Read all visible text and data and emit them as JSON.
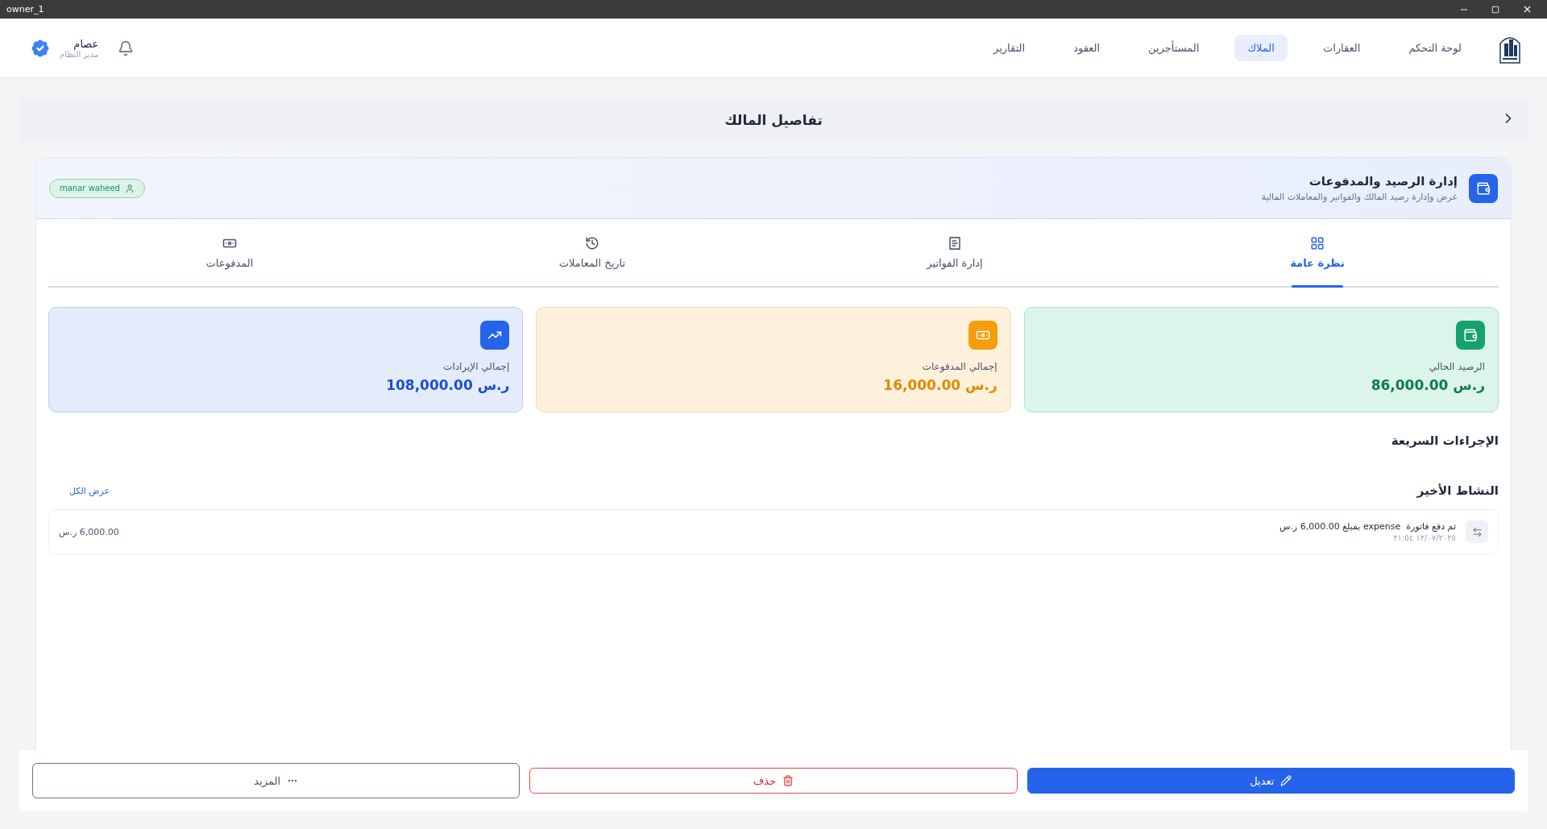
{
  "window": {
    "title": "owner_1"
  },
  "nav": {
    "items": [
      {
        "label": "لوحة التحكم",
        "selected": false
      },
      {
        "label": "العقارات",
        "selected": false
      },
      {
        "label": "الملاك",
        "selected": true
      },
      {
        "label": "المستأجرين",
        "selected": false
      },
      {
        "label": "العقود",
        "selected": false
      },
      {
        "label": "التقارير",
        "selected": false
      }
    ]
  },
  "user": {
    "name": "عصام",
    "role": "مدير النظام"
  },
  "page_title": "تفاصيل المالك",
  "section": {
    "title": "إدارة الرصيد والمدفوعات",
    "subtitle": "عرض وإدارة رصيد المالك والفواتير والمعاملات المالية",
    "owner_tag": "manar waheed"
  },
  "tabs": [
    {
      "label": "نظرة عامة",
      "selected": true,
      "kind": "grid"
    },
    {
      "label": "إدارة الفواتير",
      "selected": false,
      "kind": "invoice"
    },
    {
      "label": "تاريخ المعاملات",
      "selected": false,
      "kind": "history"
    },
    {
      "label": "المدفوعات",
      "selected": false,
      "kind": "cash"
    }
  ],
  "stats": [
    {
      "label": "الرصيد الحالي",
      "value": "86,000.00 ر.س",
      "kind": "balance"
    },
    {
      "label": "إجمالي المدفوعات",
      "value": "16,000.00 ر.س",
      "kind": "payments"
    },
    {
      "label": "إجمالي الإيرادات",
      "value": "108,000.00 ر.س",
      "kind": "revenue"
    }
  ],
  "quick_actions": {
    "title": "الإجراءات السريعة"
  },
  "recent_activity": {
    "title": "النشاط الأخير",
    "view_all": "عرض الكل",
    "rows": [
      {
        "text": "تم دفع فاتورة  expense بمبلغ 6,000.00 ر.س",
        "date": "١٢/٠٧/٢٠٢٥ ٢١:٥٤",
        "amount": "6,000.00 ر.س"
      }
    ]
  },
  "actions": [
    {
      "label": "تعديل",
      "kind": "edit"
    },
    {
      "label": "حذف",
      "kind": "delete"
    },
    {
      "label": "المزيد",
      "kind": "more"
    }
  ]
}
